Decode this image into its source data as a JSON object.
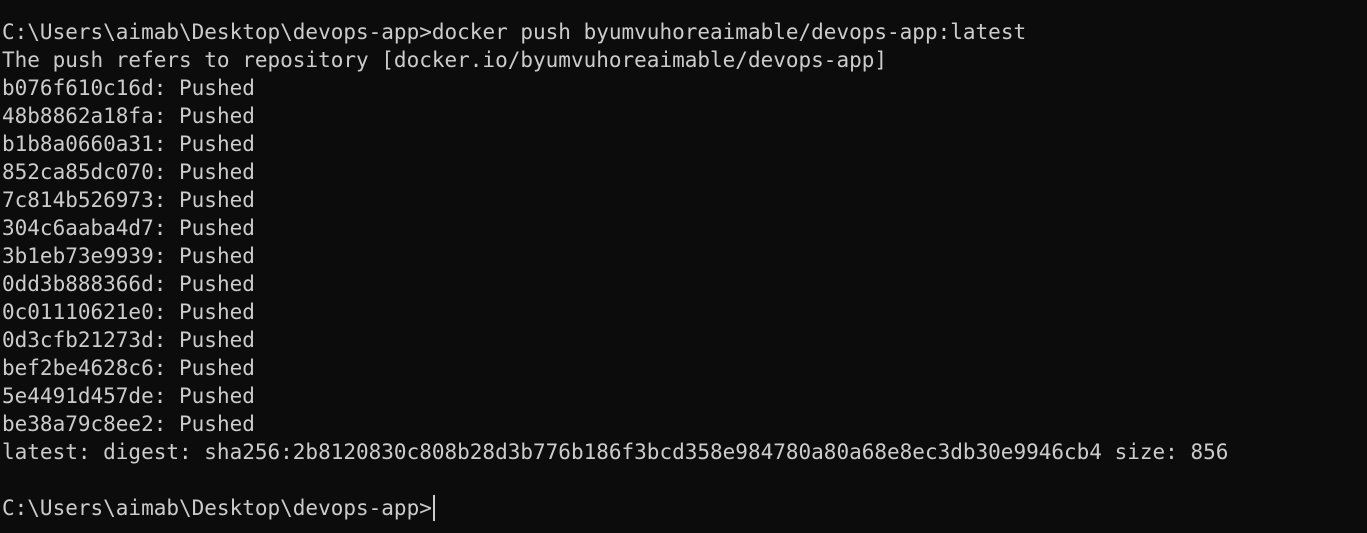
{
  "terminal": {
    "command_prompt": "C:\\Users\\aimab\\Desktop\\devops-app>",
    "command": "docker push byumvuhoreaimable/devops-app:latest",
    "refers_line": "The push refers to repository [docker.io/byumvuhoreaimable/devops-app]",
    "layers": [
      {
        "id": "b076f610c16d",
        "status": "Pushed"
      },
      {
        "id": "48b8862a18fa",
        "status": "Pushed"
      },
      {
        "id": "b1b8a0660a31",
        "status": "Pushed"
      },
      {
        "id": "852ca85dc070",
        "status": "Pushed"
      },
      {
        "id": "7c814b526973",
        "status": "Pushed"
      },
      {
        "id": "304c6aaba4d7",
        "status": "Pushed"
      },
      {
        "id": "3b1eb73e9939",
        "status": "Pushed"
      },
      {
        "id": "0dd3b888366d",
        "status": "Pushed"
      },
      {
        "id": "0c01110621e0",
        "status": "Pushed"
      },
      {
        "id": "0d3cfb21273d",
        "status": "Pushed"
      },
      {
        "id": "bef2be4628c6",
        "status": "Pushed"
      },
      {
        "id": "5e4491d457de",
        "status": "Pushed"
      },
      {
        "id": "be38a79c8ee2",
        "status": "Pushed"
      }
    ],
    "digest_line": "latest: digest: sha256:2b8120830c808b28d3b776b186f3bcd358e984780a80a68e8ec3db30e9946cb4 size: 856",
    "final_prompt": "C:\\Users\\aimab\\Desktop\\devops-app>",
    "colors": {
      "background": "#0c0c0c",
      "text": "#cccccc"
    }
  }
}
